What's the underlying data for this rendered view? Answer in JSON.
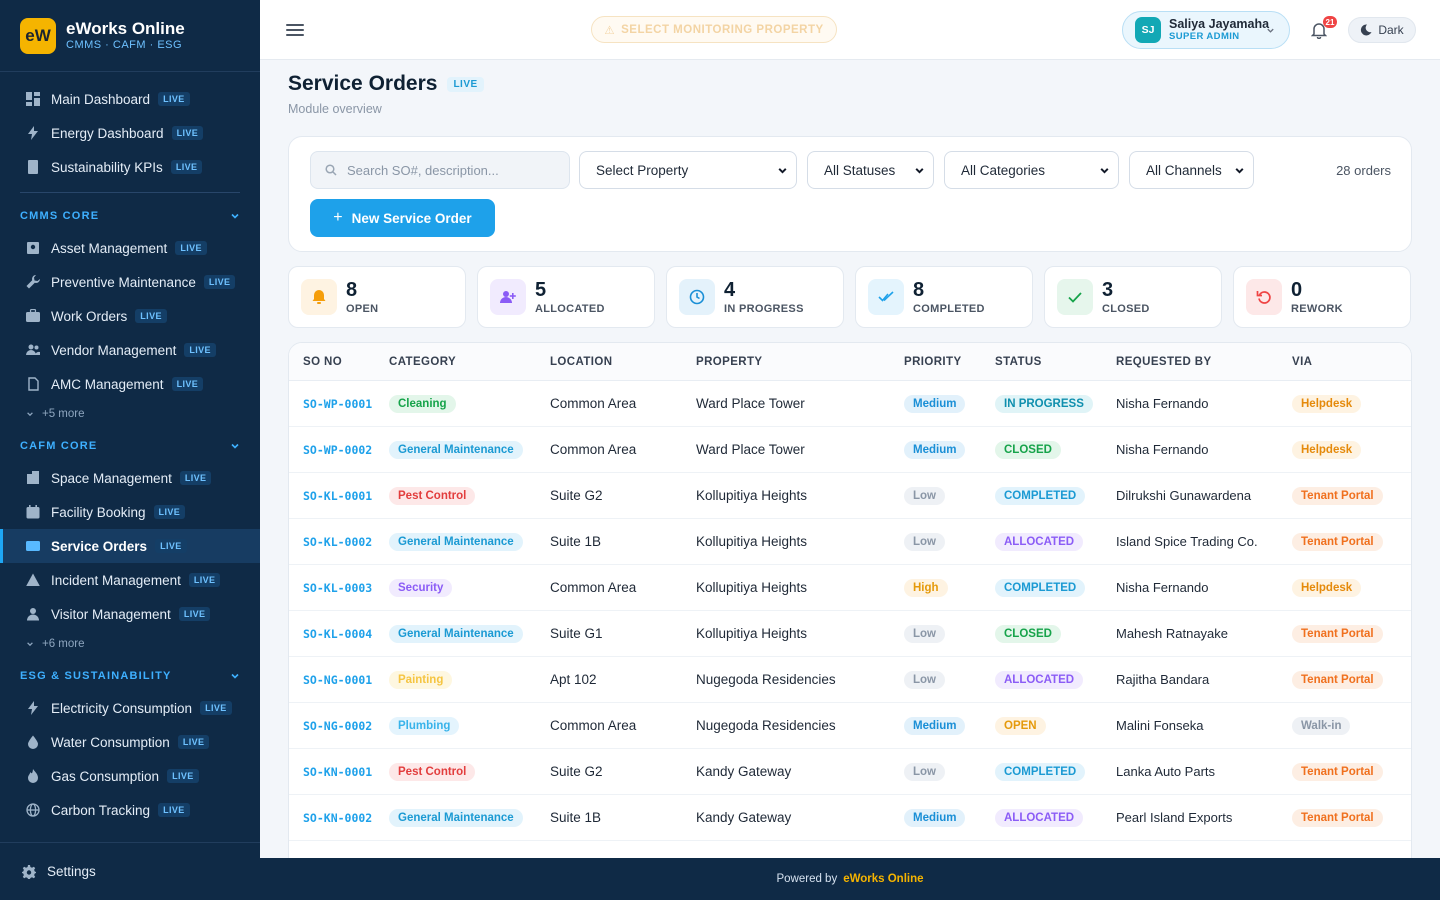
{
  "brand": {
    "logo": "eW",
    "name": "eWorks Online",
    "sub": "CMMS · CAFM · ESG"
  },
  "nav": {
    "top": [
      {
        "label": "Main Dashboard",
        "live": "LIVE",
        "icon": "grid-icon"
      },
      {
        "label": "Energy Dashboard",
        "live": "LIVE",
        "icon": "bolt-icon"
      },
      {
        "label": "Sustainability KPIs",
        "live": "LIVE",
        "icon": "document-icon"
      }
    ],
    "cmms": {
      "title": "CMMS CORE",
      "items": [
        {
          "label": "Asset Management",
          "live": "LIVE"
        },
        {
          "label": "Preventive Maintenance",
          "live": "LIVE"
        },
        {
          "label": "Work Orders",
          "live": "LIVE"
        },
        {
          "label": "Vendor Management",
          "live": "LIVE"
        },
        {
          "label": "AMC Management",
          "live": "LIVE"
        }
      ],
      "more": "+5 more"
    },
    "cafm": {
      "title": "CAFM CORE",
      "items": [
        {
          "label": "Space Management",
          "live": "LIVE"
        },
        {
          "label": "Facility Booking",
          "live": "LIVE"
        },
        {
          "label": "Service Orders",
          "live": "LIVE"
        },
        {
          "label": "Incident Management",
          "live": "LIVE"
        },
        {
          "label": "Visitor Management",
          "live": "LIVE"
        }
      ],
      "more": "+6 more"
    },
    "esg": {
      "title": "ESG & SUSTAINABILITY",
      "items": [
        {
          "label": "Electricity Consumption",
          "live": "LIVE"
        },
        {
          "label": "Water Consumption",
          "live": "LIVE"
        },
        {
          "label": "Gas Consumption",
          "live": "LIVE"
        },
        {
          "label": "Carbon Tracking",
          "live": "LIVE"
        }
      ]
    },
    "settings": "Settings"
  },
  "topbar": {
    "monitor": "SELECT MONITORING PROPERTY",
    "user_initials": "SJ",
    "user_name": "Saliya Jayamaha",
    "user_role": "SUPER ADMIN",
    "notifications": "21",
    "theme": "Dark"
  },
  "page": {
    "title": "Service Orders",
    "live": "LIVE",
    "subtitle": "Module overview"
  },
  "filters": {
    "search_placeholder": "Search SO#, description...",
    "property": "Select Property",
    "status": "All Statuses",
    "category": "All Categories",
    "channel": "All Channels",
    "count": "28 orders",
    "new_button": "New Service Order"
  },
  "stats": [
    {
      "value": "8",
      "label": "OPEN",
      "color": "#f59e0b",
      "bg": "#fef3e2"
    },
    {
      "value": "5",
      "label": "ALLOCATED",
      "color": "#8b5cf6",
      "bg": "#f1ebfe"
    },
    {
      "value": "4",
      "label": "IN PROGRESS",
      "color": "#1a8fd6",
      "bg": "#e4f2fb"
    },
    {
      "value": "8",
      "label": "COMPLETED",
      "color": "#1ea1ea",
      "bg": "#e4f4fd"
    },
    {
      "value": "3",
      "label": "CLOSED",
      "color": "#16a34a",
      "bg": "#e6f6ec"
    },
    {
      "value": "0",
      "label": "REWORK",
      "color": "#ef4444",
      "bg": "#fde8e8"
    }
  ],
  "table": {
    "headers": [
      "SO NO",
      "CATEGORY",
      "LOCATION",
      "PROPERTY",
      "PRIORITY",
      "STATUS",
      "REQUESTED BY",
      "VIA"
    ],
    "rows": [
      {
        "so": "SO-WP-0001",
        "category": "Cleaning",
        "location": "Common Area",
        "property": "Ward Place Tower",
        "priority": "Medium",
        "status": "IN PROGRESS",
        "requested": "Nisha Fernando",
        "via": "Helpdesk"
      },
      {
        "so": "SO-WP-0002",
        "category": "General Maintenance",
        "location": "Common Area",
        "property": "Ward Place Tower",
        "priority": "Medium",
        "status": "CLOSED",
        "requested": "Nisha Fernando",
        "via": "Helpdesk"
      },
      {
        "so": "SO-KL-0001",
        "category": "Pest Control",
        "location": "Suite G2",
        "property": "Kollupitiya Heights",
        "priority": "Low",
        "status": "COMPLETED",
        "requested": "Dilrukshi Gunawardena",
        "via": "Tenant Portal"
      },
      {
        "so": "SO-KL-0002",
        "category": "General Maintenance",
        "location": "Suite 1B",
        "property": "Kollupitiya Heights",
        "priority": "Low",
        "status": "ALLOCATED",
        "requested": "Island Spice Trading Co.",
        "via": "Tenant Portal"
      },
      {
        "so": "SO-KL-0003",
        "category": "Security",
        "location": "Common Area",
        "property": "Kollupitiya Heights",
        "priority": "High",
        "status": "COMPLETED",
        "requested": "Nisha Fernando",
        "via": "Helpdesk"
      },
      {
        "so": "SO-KL-0004",
        "category": "General Maintenance",
        "location": "Suite G1",
        "property": "Kollupitiya Heights",
        "priority": "Low",
        "status": "CLOSED",
        "requested": "Mahesh Ratnayake",
        "via": "Tenant Portal"
      },
      {
        "so": "SO-NG-0001",
        "category": "Painting",
        "location": "Apt 102",
        "property": "Nugegoda Residencies",
        "priority": "Low",
        "status": "ALLOCATED",
        "requested": "Rajitha Bandara",
        "via": "Tenant Portal"
      },
      {
        "so": "SO-NG-0002",
        "category": "Plumbing",
        "location": "Common Area",
        "property": "Nugegoda Residencies",
        "priority": "Medium",
        "status": "OPEN",
        "requested": "Malini Fonseka",
        "via": "Walk-in"
      },
      {
        "so": "SO-KN-0001",
        "category": "Pest Control",
        "location": "Suite G2",
        "property": "Kandy Gateway",
        "priority": "Low",
        "status": "COMPLETED",
        "requested": "Lanka Auto Parts",
        "via": "Tenant Portal"
      },
      {
        "so": "SO-KN-0002",
        "category": "General Maintenance",
        "location": "Suite 1B",
        "property": "Kandy Gateway",
        "priority": "Medium",
        "status": "ALLOCATED",
        "requested": "Pearl Island Exports",
        "via": "Tenant Portal"
      }
    ]
  },
  "footer": {
    "prefix": "Powered by",
    "brand": "eWorks Online"
  }
}
